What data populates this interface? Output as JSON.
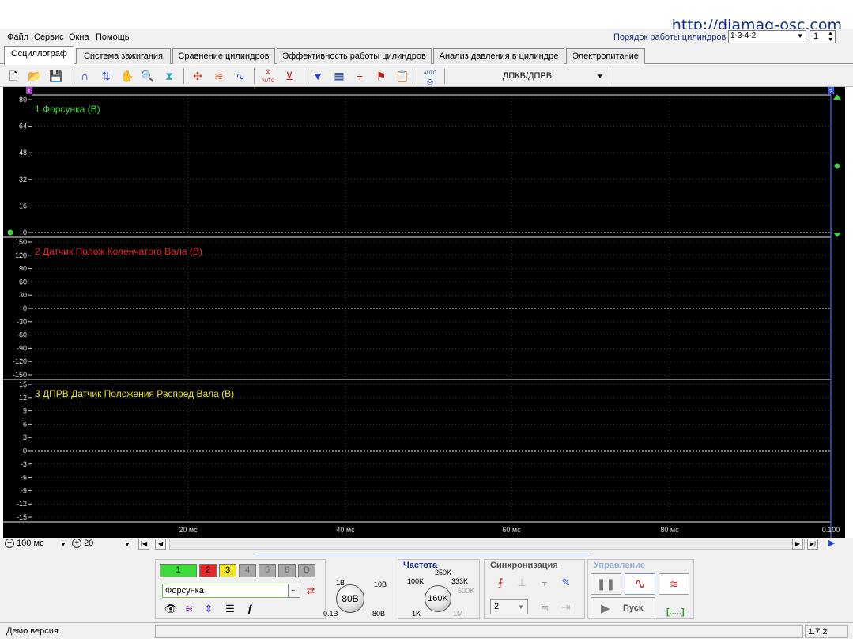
{
  "watermark": "http://diamag-osc.com",
  "menu": [
    "Файл",
    "Сервис",
    "Окна",
    "Помощь"
  ],
  "cylinders": {
    "label": "Порядок работы цилиндров",
    "order": "1-3-4-2",
    "count": "1"
  },
  "tabs": [
    "Осциллограф",
    "Система зажигания",
    "Сравнение цилиндров",
    "Эффективность работы цилиндров",
    "Анализ давления в цилиндре",
    "Электропитание"
  ],
  "toolbar": {
    "icons": [
      "new-file-icon",
      "open-folder-icon",
      "save-icon",
      "arc-tool-icon",
      "cursor-measure-icon",
      "hand-pan-icon",
      "zoom-icon",
      "filter-icon",
      "signal-cross-icon",
      "wave-multi-icon",
      "wave-compare-icon",
      "auto-scale-icon",
      "zero-level-icon",
      "channel-filter-icon",
      "table-icon",
      "split-icon",
      "marker-flag-icon",
      "notes-icon",
      "auto-detect-icon"
    ],
    "auto_label": "AUTO",
    "mode": "ДПКВ/ДПРВ"
  },
  "scope": {
    "channels": [
      {
        "title": "1 Форсунка (В)",
        "color": "#3cd63c",
        "ticks": [
          "80",
          "64",
          "48",
          "32",
          "16",
          "0"
        ]
      },
      {
        "title": "2 Датчик Полож Коленчатого Вала (В)",
        "color": "#e8282a",
        "ticks": [
          "150",
          "120",
          "90",
          "60",
          "30",
          "0",
          "-30",
          "-60",
          "-90",
          "-120",
          "-150"
        ]
      },
      {
        "title": "3 ДПРВ Датчик Положения Распред Вала (В)",
        "color": "#e6e22a",
        "ticks": [
          "15",
          "12",
          "9",
          "6",
          "3",
          "0",
          "-3",
          "-6",
          "-9",
          "-12",
          "-15"
        ]
      }
    ],
    "time_labels": [
      "20 мс",
      "40 мс",
      "60 мс",
      "80 мс",
      "0.100"
    ],
    "marker_left": "1",
    "marker_right": "2"
  },
  "hscroll": {
    "timebase": "100 мс",
    "points": "20"
  },
  "channel_panel": {
    "buttons": [
      "1",
      "2",
      "3",
      "4",
      "5",
      "6",
      "D"
    ],
    "colors": [
      "#3ddc3d",
      "#e62828",
      "#f0e628",
      "#a8a8a8",
      "#a8a8a8",
      "#a8a8a8",
      "#a8a8a8"
    ],
    "name": "Форсунка",
    "dots": "..."
  },
  "volt_knob": {
    "value": "80В",
    "labels": [
      "1В",
      "10В",
      "0.1В",
      "80В"
    ]
  },
  "freq": {
    "title": "Частота",
    "value": "160K",
    "labels": [
      "250K",
      "100K",
      "333K",
      "500K",
      "1K",
      "1M"
    ]
  },
  "sync": {
    "title": "Синхронизация",
    "value": "2"
  },
  "control": {
    "title": "Управление",
    "start": "Пуск",
    "indicator": "[.....]"
  },
  "status": {
    "text": "Демо версия",
    "version": "1.7.2"
  }
}
